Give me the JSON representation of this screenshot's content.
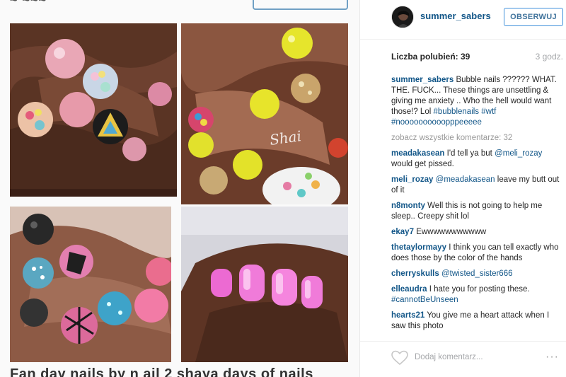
{
  "post": {
    "username": "summer_sabers",
    "follow_label": "OBSERWUJ",
    "likes_label": "Liczba polubień: 39",
    "time": "3 godz.",
    "watermark": "Shai",
    "bottom_caption": "Fan day nails by n ail 2 shaya days of nails"
  },
  "comments": [
    {
      "user": "summer_sabers",
      "text": "Bubble nails ?????? WHAT. THE. FUCK... These things are unsettling & giving me anxiety .. Who the hell would want those!? Lol",
      "tags": "#bubblenails #wtf #noooooooooopppeeeee"
    },
    {
      "view_all": "zobacz wszystkie komentarze: 32"
    },
    {
      "user": "meadakasean",
      "text": "I'd tell ya but",
      "mention": "@meli_rozay",
      "text2": "would get pissed."
    },
    {
      "user": "meli_rozay",
      "mention": "@meadakasean",
      "text2": "leave my butt out of it"
    },
    {
      "user": "n8monty",
      "text": "Well this is not going to help me sleep.. Creepy shit lol"
    },
    {
      "user": "ekay7",
      "text": "Ewwwwwwwwwww"
    },
    {
      "user": "thetaylormayy",
      "text": "I think you can tell exactly who does those by the color of the hands"
    },
    {
      "user": "cherryskulls",
      "mention": "@twisted_sister666"
    },
    {
      "user": "elleaudra",
      "text": "I hate you for posting these.",
      "tags": "#cannotBeUnseen"
    },
    {
      "user": "hearts21",
      "text": "You give me a heart attack when I saw this photo"
    }
  ],
  "footer": {
    "add_comment_placeholder": "Dodaj komentarz...",
    "more_icon": "···"
  },
  "colors": {
    "link": "#125688",
    "follow_border": "#4090db",
    "muted": "#a5a7aa"
  },
  "icons": [
    "heart-icon",
    "more-options-icon",
    "avatar"
  ]
}
